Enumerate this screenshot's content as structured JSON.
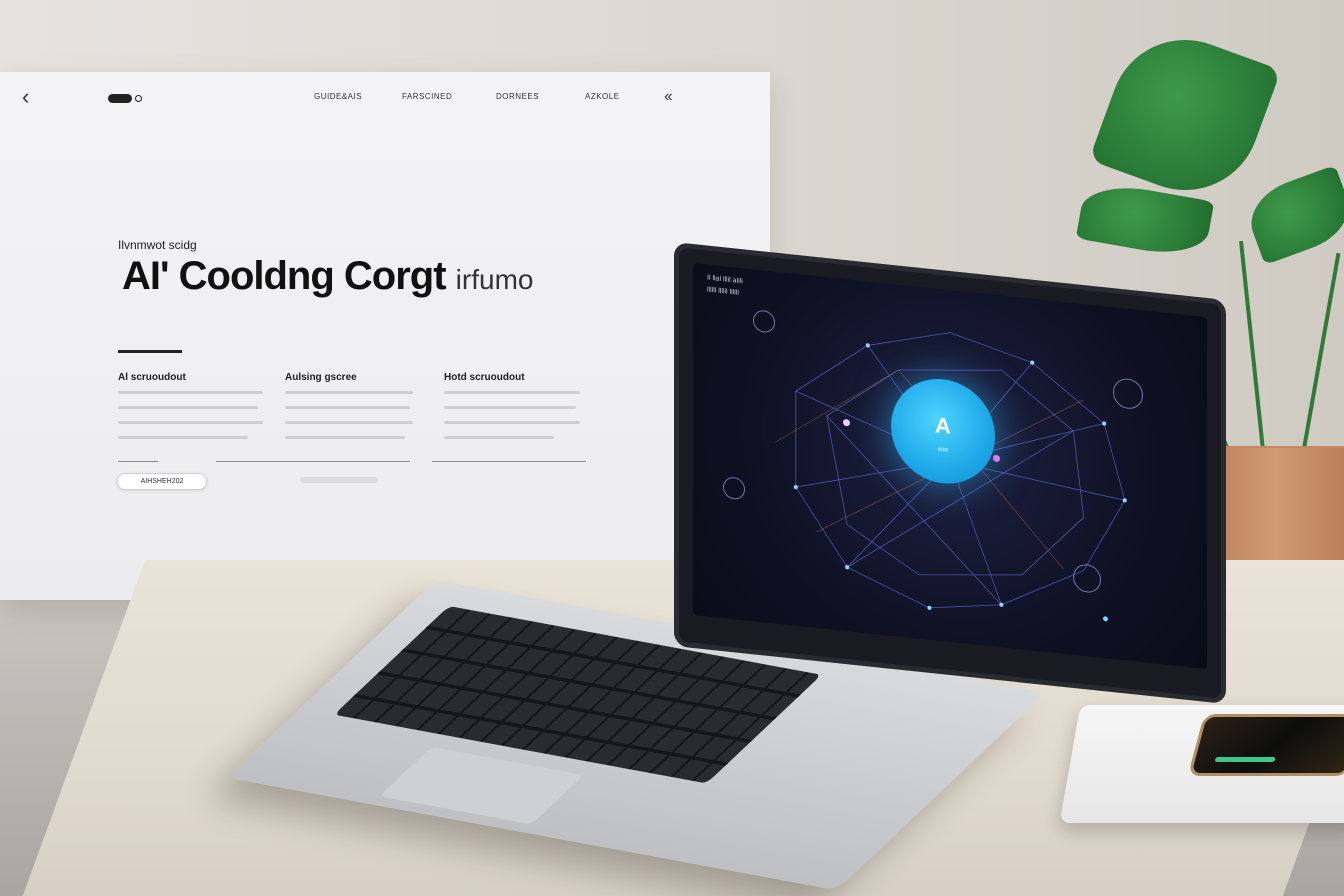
{
  "panel": {
    "nav": {
      "back_glyph": "‹",
      "links": [
        "GUIDE&AIS",
        "FARSCINED",
        "DORNEES",
        "AZKOLE"
      ],
      "forward_glyph": "‹‹"
    },
    "kicker": "Ilvnmwot scidg",
    "headline": "AI' Cooldng  Corgt",
    "headline_suffix": "irfumo",
    "columns": [
      {
        "title": "Al scruoudout"
      },
      {
        "title": "Aulsing gscree"
      },
      {
        "title": "Hotd scruoudout"
      }
    ],
    "cta_label": "AIHSHEH202"
  },
  "laptop": {
    "screen_title": "Il llal lllil alili",
    "screen_subtitle": "llllll llllil llllll",
    "core_label": "lllllllll",
    "core_glyph": "A"
  },
  "colors": {
    "panel_bg": "#f0f0f2",
    "screen_bg": "#0f1124",
    "core_accent": "#1da8e8",
    "plant_green": "#2f7a36",
    "pot_terracotta": "#c28a63"
  }
}
